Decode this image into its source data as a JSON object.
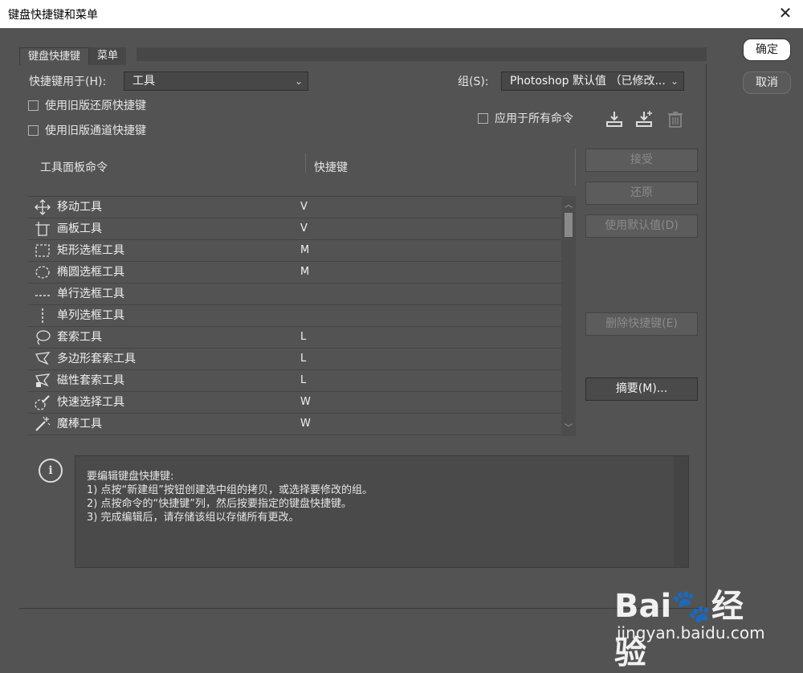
{
  "window": {
    "title": "键盘快捷键和菜单",
    "close_glyph": "✕"
  },
  "tabs": [
    {
      "label": "键盘快捷键",
      "active": true
    },
    {
      "label": "菜单",
      "active": false
    }
  ],
  "shortcuts_for": {
    "label": "快捷键用于(H):",
    "value": "工具"
  },
  "group": {
    "label": "组(S):",
    "value": "Photoshop 默认值 （已修改..."
  },
  "checkboxes": {
    "legacy_undo": "使用旧版还原快捷键",
    "legacy_channel": "使用旧版通道快捷键",
    "apply_all": "应用于所有命令"
  },
  "icons": {
    "save_set": "save-set-icon",
    "new_set": "new-set-icon",
    "delete_set": "trash-icon"
  },
  "table": {
    "col_command": "工具面板命令",
    "col_shortcut": "快捷键",
    "rows": [
      {
        "icon": "move-icon",
        "name": "移动工具",
        "key": "V"
      },
      {
        "icon": "artboard-icon",
        "name": "画板工具",
        "key": "V"
      },
      {
        "icon": "rect-marquee-icon",
        "name": "矩形选框工具",
        "key": "M"
      },
      {
        "icon": "ellipse-marquee-icon",
        "name": "椭圆选框工具",
        "key": "M"
      },
      {
        "icon": "single-row-icon",
        "name": "单行选框工具",
        "key": ""
      },
      {
        "icon": "single-col-icon",
        "name": "单列选框工具",
        "key": ""
      },
      {
        "icon": "lasso-icon",
        "name": "套索工具",
        "key": "L"
      },
      {
        "icon": "polygon-lasso-icon",
        "name": "多边形套索工具",
        "key": "L"
      },
      {
        "icon": "magnetic-lasso-icon",
        "name": "磁性套索工具",
        "key": "L"
      },
      {
        "icon": "quick-select-icon",
        "name": "快速选择工具",
        "key": "W"
      },
      {
        "icon": "magic-wand-icon",
        "name": "魔棒工具",
        "key": "W"
      }
    ]
  },
  "side_buttons": {
    "accept": "接受",
    "undo": "还原",
    "use_default": "使用默认值(D)",
    "delete_shortcut": "删除快捷键(E)",
    "summary": "摘要(M)..."
  },
  "dialog_buttons": {
    "ok": "确定",
    "cancel": "取消"
  },
  "info": {
    "lines": [
      "要编辑键盘快捷键:",
      "1) 点按“新建组”按钮创建选中组的拷贝，或选择要修改的组。",
      "2) 点按命令的“快捷键”列，然后按要指定的键盘快捷键。",
      "3) 完成编辑后，请存储该组以存储所有更改。"
    ]
  },
  "watermark": {
    "logo": "Bai🐾经验",
    "url": "jingyan.baidu.com"
  }
}
